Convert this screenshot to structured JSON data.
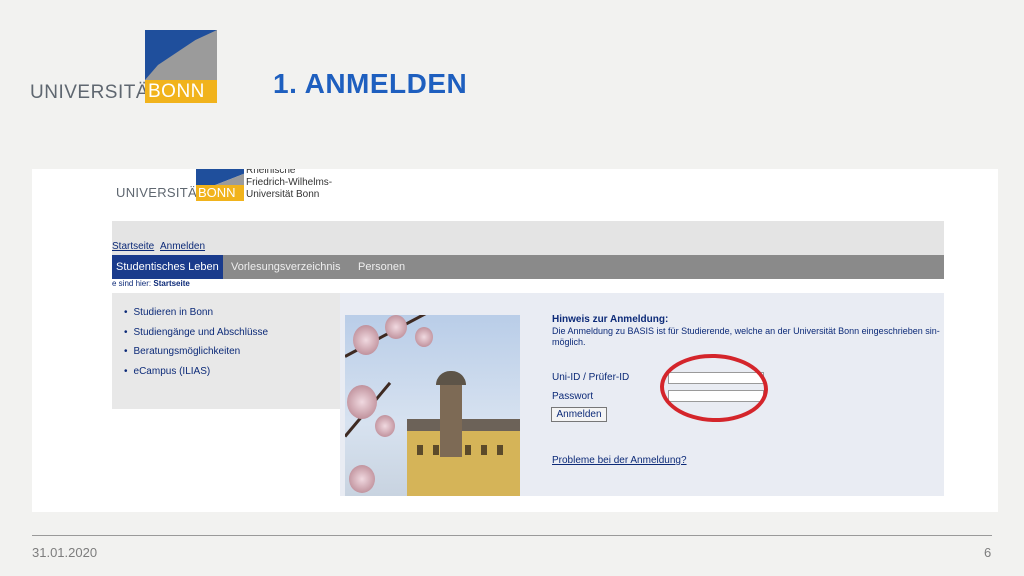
{
  "slide": {
    "logo": {
      "text": "UNIVERSITÄT",
      "badge": "BONN"
    },
    "title": "1. ANMELDEN",
    "footer": {
      "date": "31.01.2020",
      "page": "6"
    }
  },
  "screenshot": {
    "logo": {
      "text": "UNIVERSITÄT",
      "badge": "BONN",
      "subtitle": [
        "Rheinische",
        "Friedrich-Wilhelms-",
        "Universität Bonn"
      ]
    },
    "links": [
      "Startseite",
      "Anmelden"
    ],
    "nav": [
      "Studentisches Leben",
      "Vorlesungsverzeichnis",
      "Personen"
    ],
    "breadcrumb": {
      "prefix": "e sind hier:",
      "current": "Startseite"
    },
    "sidebar": [
      "Studieren in Bonn",
      "Studiengänge und Abschlüsse",
      "Beratungsmöglichkeiten",
      "eCampus (ILIAS)"
    ],
    "login": {
      "hint_title": "Hinweis zur Anmeldung:",
      "hint_text": "Die Anmeldung zu BASIS ist für Studierende, welche an der Universität Bonn eingeschrieben sin- möglich.",
      "user_label": "Uni-ID / Prüfer-ID",
      "password_label": "Passwort",
      "button": "Anmelden",
      "problem_link": "Probleme bei der Anmeldung?"
    },
    "annotation_color": "#d4252b"
  },
  "colors": {
    "title": "#1e5fbf",
    "brand_blue": "#1f4f9c",
    "brand_yellow": "#f1b31c",
    "nav_gray": "#8a8a8a",
    "nav_active": "#1a3b8c"
  }
}
